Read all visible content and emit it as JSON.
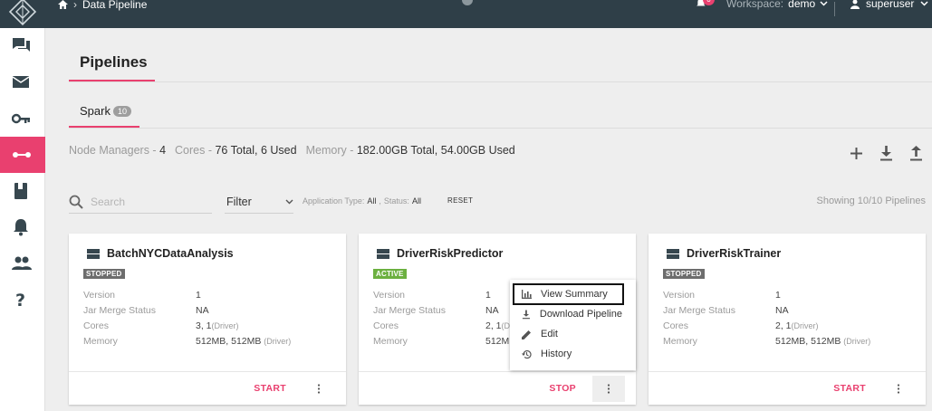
{
  "topbar": {
    "breadcrumb": "Data Pipeline",
    "notification_count": "0",
    "workspace_label": "Workspace:",
    "workspace_value": "demo",
    "user_name": "superuser"
  },
  "page": {
    "title": "Pipelines",
    "tab_label": "Spark",
    "tab_count": "10"
  },
  "stats": {
    "node_managers_label": "Node Managers -",
    "node_managers_value": "4",
    "cores_label": "Cores -",
    "cores_value": "76 Total, 6 Used",
    "memory_label": "Memory -",
    "memory_value": "182.00GB Total, 54.00GB Used"
  },
  "filters": {
    "search_placeholder": "Search",
    "filter_label": "Filter",
    "app_type_label": "Application Type:",
    "app_type_value": "All",
    "status_label": "Status:",
    "status_value": "All",
    "reset_label": "RESET",
    "showing_text": "Showing 10/10 Pipelines"
  },
  "labels": {
    "version": "Version",
    "jar_merge_status": "Jar Merge Status",
    "cores": "Cores",
    "memory": "Memory"
  },
  "cards": [
    {
      "name": "BatchNYCDataAnalysis",
      "status": "STOPPED",
      "version": "1",
      "jar_merge_status": "NA",
      "cores": "3, 1",
      "cores_note": "(Driver)",
      "memory": "512MB, 512MB",
      "memory_note": "(Driver)",
      "action": "START"
    },
    {
      "name": "DriverRiskPredictor",
      "status": "ACTIVE",
      "version": "1",
      "jar_merge_status": "NA",
      "cores": "2, 1",
      "cores_note": "(Dr",
      "memory": "512M",
      "memory_note": "",
      "action": "STOP"
    },
    {
      "name": "DriverRiskTrainer",
      "status": "STOPPED",
      "version": "1",
      "jar_merge_status": "NA",
      "cores": "2, 1",
      "cores_note": "(Driver)",
      "memory": "512MB, 512MB",
      "memory_note": "(Driver)",
      "action": "START"
    }
  ],
  "context_menu": {
    "items": [
      "View Summary",
      "Download Pipeline",
      "Edit",
      "History"
    ]
  },
  "colors": {
    "accent": "#e9406f",
    "topbar": "#2f3f48",
    "active_badge": "#6cb040",
    "stopped_badge": "#6d6d6d"
  }
}
